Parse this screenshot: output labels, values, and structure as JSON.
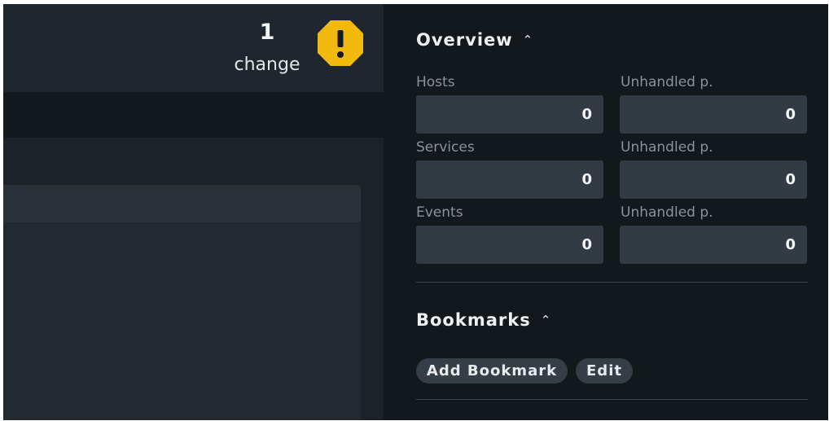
{
  "header": {
    "change_count": "1",
    "change_label": "change",
    "warning_icon": "warning-octagon-icon",
    "warning_color": "#f2b90f"
  },
  "overview": {
    "title": "Overview",
    "chevron": "⌃",
    "rows": [
      {
        "label": "Hosts",
        "value": "0",
        "unhandled_label": "Unhandled p.",
        "unhandled_value": "0"
      },
      {
        "label": "Services",
        "value": "0",
        "unhandled_label": "Unhandled p.",
        "unhandled_value": "0"
      },
      {
        "label": "Events",
        "value": "0",
        "unhandled_label": "Unhandled p.",
        "unhandled_value": "0"
      }
    ]
  },
  "bookmarks": {
    "title": "Bookmarks",
    "chevron": "⌃",
    "add_label": "Add Bookmark",
    "edit_label": "Edit"
  }
}
